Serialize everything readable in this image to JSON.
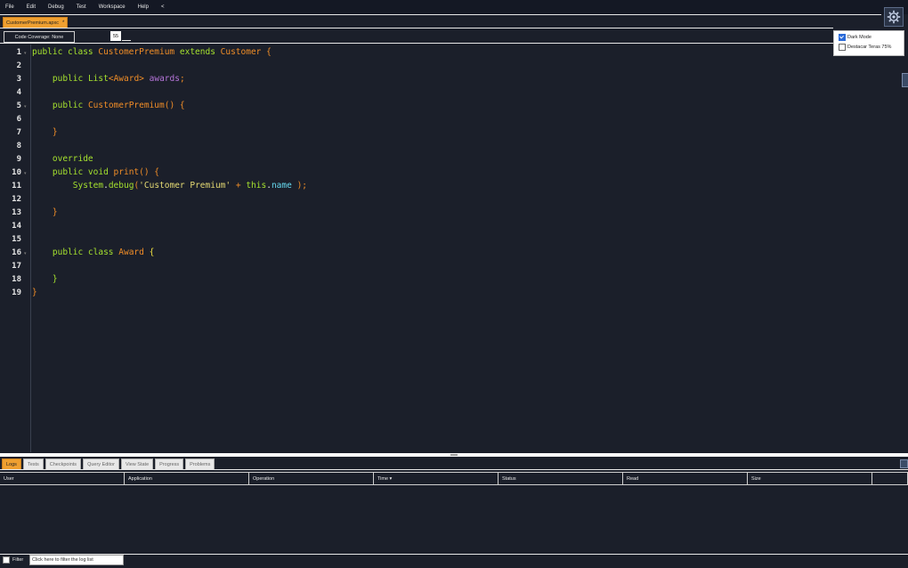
{
  "menu": [
    "File",
    "Edit",
    "Debug",
    "Test",
    "Workspace",
    "Help",
    "<"
  ],
  "file_tab": {
    "label": "CustomerPremium.apxc",
    "modified": "*"
  },
  "toolbar": {
    "coverage_label": "Code Coverage: None",
    "font_size": "55"
  },
  "settings_popup": {
    "dark_mode_label": "Dark Mode",
    "dark_mode_checked": true,
    "contrast_label": "Destacar Teras 75%",
    "contrast_checked": false
  },
  "editor": {
    "line_numbers": [
      "1",
      "2",
      "3",
      "4",
      "5",
      "6",
      "7",
      "8",
      "9",
      "10",
      "11",
      "12",
      "13",
      "14",
      "15",
      "16",
      "17",
      "18",
      "19"
    ],
    "fold_lines": [
      1,
      5,
      10,
      16
    ],
    "lines": [
      [
        [
          "kw",
          "public class "
        ],
        [
          "ty",
          "CustomerPremium"
        ],
        [
          "kw",
          " extends "
        ],
        [
          "ty",
          "Customer"
        ],
        [
          "pu",
          " {"
        ]
      ],
      [],
      [
        [
          "tx",
          "    "
        ],
        [
          "kw",
          "public "
        ],
        [
          "fn",
          "List"
        ],
        [
          "pu",
          "<"
        ],
        [
          "ty",
          "Award"
        ],
        [
          "pu",
          "> "
        ],
        [
          "fld",
          "awards"
        ],
        [
          "pu",
          ";"
        ]
      ],
      [],
      [
        [
          "tx",
          "    "
        ],
        [
          "kw",
          "public "
        ],
        [
          "ty",
          "CustomerPremium"
        ],
        [
          "pu",
          "() {"
        ]
      ],
      [],
      [
        [
          "tx",
          "    "
        ],
        [
          "pu",
          "}"
        ]
      ],
      [],
      [
        [
          "tx",
          "    "
        ],
        [
          "kw",
          "override"
        ]
      ],
      [
        [
          "tx",
          "    "
        ],
        [
          "kw",
          "public void "
        ],
        [
          "ty",
          "print"
        ],
        [
          "pu",
          "() {"
        ]
      ],
      [
        [
          "tx",
          "        "
        ],
        [
          "fn",
          "System"
        ],
        [
          "tx",
          "."
        ],
        [
          "fn",
          "debug"
        ],
        [
          "pu",
          "("
        ],
        [
          "str",
          "'Customer Premium'"
        ],
        [
          "tx",
          " "
        ],
        [
          "pu",
          "+"
        ],
        [
          "tx",
          " "
        ],
        [
          "kw",
          "this"
        ],
        [
          "tx",
          "."
        ],
        [
          "pr",
          "name"
        ],
        [
          "tx",
          " "
        ],
        [
          "pu",
          ");"
        ]
      ],
      [],
      [
        [
          "tx",
          "    "
        ],
        [
          "pu",
          "}"
        ]
      ],
      [],
      [],
      [
        [
          "tx",
          "    "
        ],
        [
          "kw",
          "public class "
        ],
        [
          "ty",
          "Award"
        ],
        [
          "tx",
          " "
        ],
        [
          "yb",
          "{"
        ]
      ],
      [],
      [
        [
          "tx",
          "    "
        ],
        [
          "kw",
          "}"
        ]
      ],
      [
        [
          "pu",
          "}"
        ]
      ]
    ]
  },
  "bottom_tabs": [
    "Logs",
    "Tests",
    "Checkpoints",
    "Query Editor",
    "View State",
    "Progress",
    "Problems"
  ],
  "bottom_active_tab": 0,
  "log_table": {
    "columns": [
      "User",
      "Application",
      "Operation",
      "Time ▾",
      "Status",
      "Read",
      "Size"
    ]
  },
  "filter": {
    "label": "Filter",
    "placeholder": "Click here to filter the log list"
  }
}
